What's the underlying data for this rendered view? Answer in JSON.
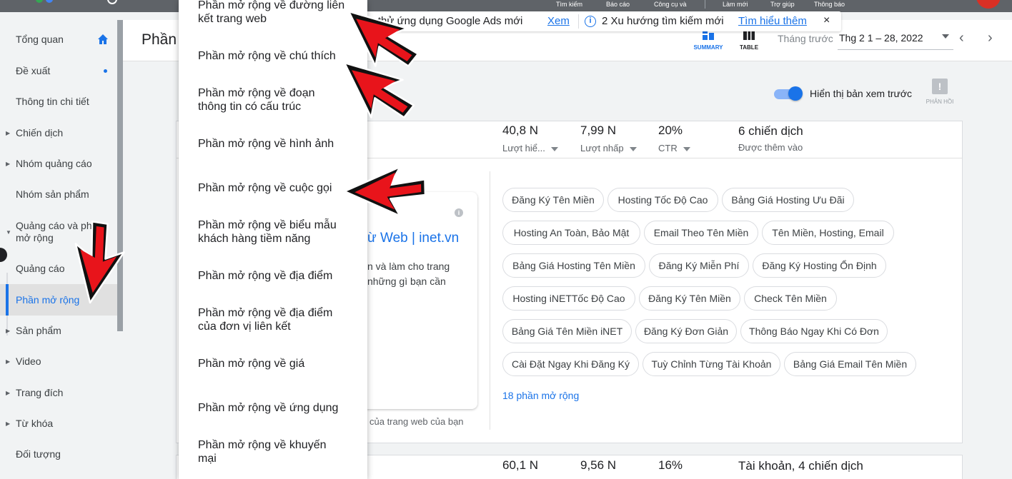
{
  "topbar": {
    "nav": [
      "Tìm kiếm",
      "Báo cáo",
      "Công cụ và",
      "Làm mới",
      "Trợ giúp",
      "Thông báo"
    ]
  },
  "sidebar": {
    "items": [
      {
        "label": "Tổng quan"
      },
      {
        "label": "Đề xuất"
      },
      {
        "label": "Thông tin chi tiết"
      },
      {
        "label": "Chiến dịch"
      },
      {
        "label": "Nhóm quảng cáo"
      },
      {
        "label": "Nhóm sản phẩm"
      },
      {
        "label": "Quảng cáo và phần mở rộng"
      },
      {
        "label": "Quảng cáo"
      },
      {
        "label": "Phần mở rộng"
      },
      {
        "label": "Sản phẩm"
      },
      {
        "label": "Video"
      },
      {
        "label": "Trang đích"
      },
      {
        "label": "Từ khóa"
      },
      {
        "label": "Đối tượng"
      }
    ]
  },
  "header": {
    "title": "Phần",
    "summary_label": "SUMMARY",
    "table_label": "TABLE",
    "date_prefix": "Tháng trước",
    "date_range": "Thg 2 1 – 28, 2022"
  },
  "notification": {
    "text1": "ng thử ứng dụng Google Ads mới",
    "link1": "Xem",
    "text2": "2 Xu hướng tìm kiếm mới",
    "link2": "Tìm hiểu thêm",
    "close": "×"
  },
  "preview": {
    "label": "Hiển thị bản xem trước",
    "feedback": "PHẢN HỒI"
  },
  "card1": {
    "metrics": [
      {
        "value": "40,8 N",
        "label": "Lượt hiể..."
      },
      {
        "value": "7,99 N",
        "label": "Lượt nhấp"
      },
      {
        "value": "20%",
        "label": "CTR"
      },
      {
        "value": "6 chiến dịch",
        "label": "Được thêm vào"
      }
    ],
    "ad_title": "ừ Web | inet.vn",
    "ad_desc": "n và làm cho trang những gì bạn cần",
    "ad_caption": "của trang web của bạn",
    "chips": [
      "Đăng Ký Tên Miền",
      "Hosting Tốc Độ Cao",
      "Bảng Giá Hosting Ưu Đãi",
      "Hosting An Toàn, Bảo Mật",
      "Email Theo Tên Miền",
      "Tên Miền, Hosting, Email",
      "Bảng Giá Hosting Tên Miền",
      "Đăng Ký Miễn Phí",
      "Đăng Ký Hosting Ổn Định",
      "Hosting iNETTốc Độ Cao",
      "Đăng Ký Tên Miền",
      "Check Tên Miền",
      "Bảng Giá Tên Miền iNET",
      "Đăng Ký Đơn Giản",
      "Thông Báo Ngay Khi Có Đơn",
      "Cài Đặt Ngay Khi Đăng Ký",
      "Tuỳ Chỉnh Từng Tài Khoản",
      "Bảng Giá Email Tên Miền"
    ],
    "more_link": "18 phần mở rộng"
  },
  "card2": {
    "metrics": [
      {
        "value": "60,1 N"
      },
      {
        "value": "9,56 N"
      },
      {
        "value": "16%"
      },
      {
        "value": "Tài khoản, 4 chiến dịch"
      }
    ]
  },
  "menu": {
    "items": [
      "Phần mở rộng về đường liên kết trang web",
      "Phần mở rộng về chú thích",
      "Phần mở rộng về đoạn thông tin có cấu trúc",
      "Phần mở rộng về hình ảnh",
      "Phần mở rộng về cuộc gọi",
      "Phần mở rộng về biểu mẫu khách hàng tiềm năng",
      "Phần mở rộng về địa điểm",
      "Phần mở rộng về địa điểm của đơn vị liên kết",
      "Phần mở rộng về giá",
      "Phần mở rộng về ứng dụng",
      "Phần mở rộng về khuyến mại"
    ]
  },
  "colors": {
    "accent": "#1a73e8",
    "arrow_fill": "#e8141b"
  }
}
